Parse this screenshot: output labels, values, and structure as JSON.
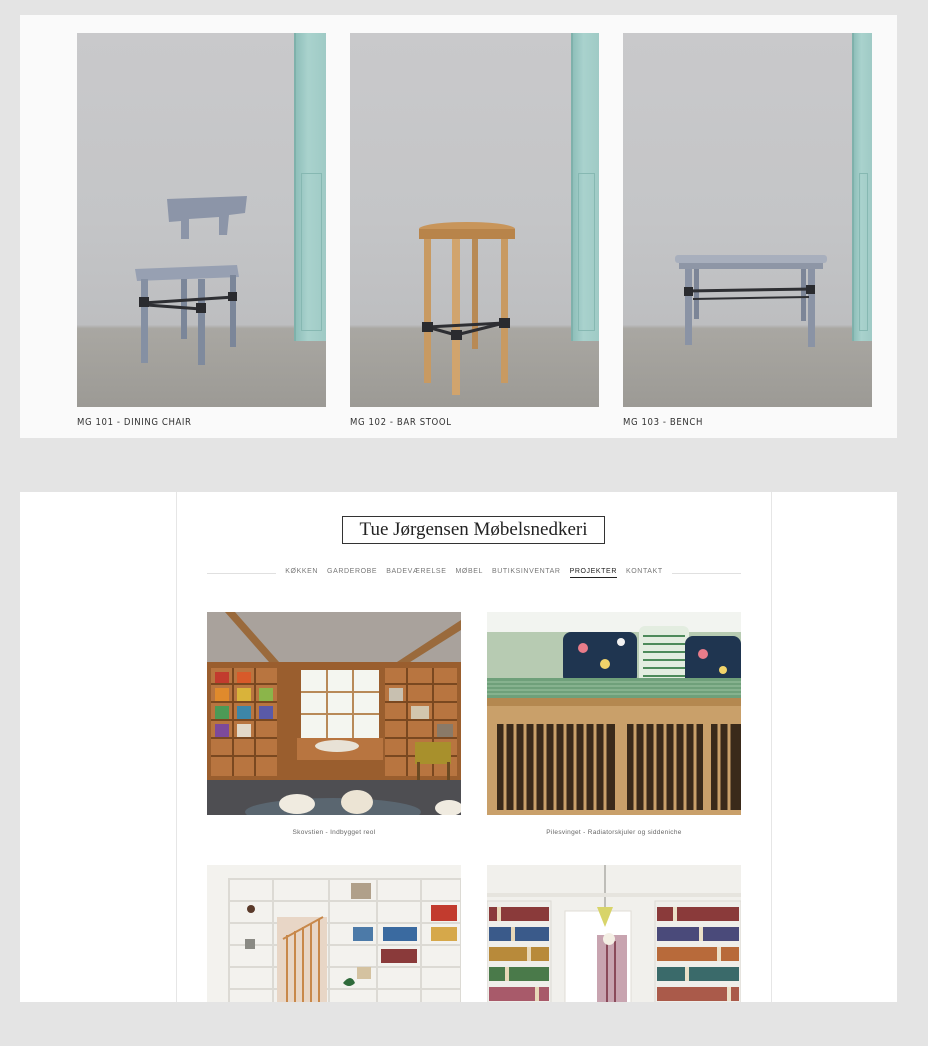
{
  "products": [
    {
      "caption": "MG 101 - DINING CHAIR",
      "image_icon": "dining-chair-photo"
    },
    {
      "caption": "MG 102 - BAR STOOL",
      "image_icon": "bar-stool-photo"
    },
    {
      "caption": "MG 103 - BENCH",
      "image_icon": "bench-photo"
    }
  ],
  "site": {
    "logo": "Tue Jørgensen Møbelsnedkeri",
    "nav": [
      "KØKKEN",
      "GARDEROBE",
      "BADEVÆRELSE",
      "MØBEL",
      "BUTIKSINVENTAR",
      "PROJEKTER",
      "KONTAKT"
    ],
    "active_nav": "PROJEKTER"
  },
  "projects": [
    {
      "caption": "Skovstien - Indbygget reol"
    },
    {
      "caption": "Pilesvinget - Radiatorskjuler og siddeniche"
    },
    {
      "caption": ""
    },
    {
      "caption": ""
    }
  ],
  "colors": {
    "page_bg": "#e4e4e4",
    "wall_mint": "#a9d2cd",
    "chair_blue_grey": "#8a93a6",
    "oak": "#c8955a"
  }
}
